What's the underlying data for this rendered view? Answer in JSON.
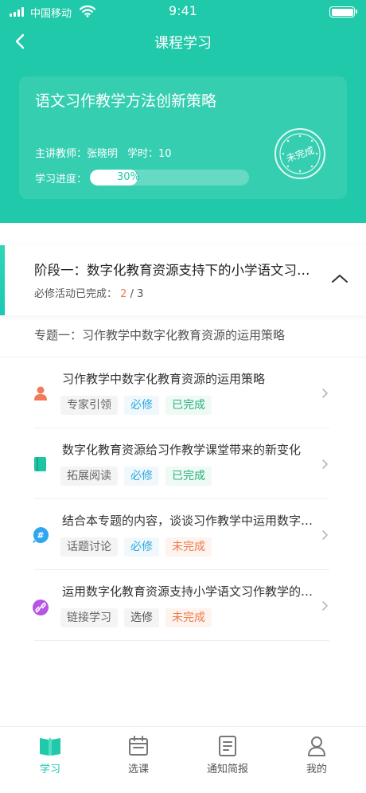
{
  "status_bar": {
    "carrier": "中国移动",
    "time": "9:41"
  },
  "nav": {
    "title": "课程学习"
  },
  "course": {
    "title": "语文习作教学方法创新策略",
    "teacher": "主讲教师：张晓明",
    "hours": "学时：10",
    "progress_label": "学习进度：",
    "progress_value": 30,
    "progress_text": "30%",
    "stamp_text": "未完成"
  },
  "stage": {
    "title": "阶段一：数字化教育资源支持下的小学语文习作教学",
    "progress_label": "必修活动已完成：",
    "completed": "2",
    "separator": "/",
    "total": "3"
  },
  "topic": {
    "title": "专题一：习作教学中数字化教育资源的运用策略"
  },
  "activities": [
    {
      "title": "习作教学中数字化教育资源的运用策略",
      "type": "专家引领",
      "requirement": "必修",
      "status": "已完成",
      "icon": "expert-icon"
    },
    {
      "title": "数字化教育资源给习作教学课堂带来的新变化",
      "type": "拓展阅读",
      "requirement": "必修",
      "status": "已完成",
      "icon": "book-icon"
    },
    {
      "title": "结合本专题的内容，谈谈习作教学中运用数字化教育资源的体会",
      "type": "话题讨论",
      "requirement": "必修",
      "status": "未完成",
      "icon": "topic-icon"
    },
    {
      "title": "运用数字化教育资源支持小学语文习作教学的案例",
      "type": "链接学习",
      "requirement": "选修",
      "status": "未完成",
      "icon": "link-icon"
    }
  ],
  "tabbar": {
    "items": [
      {
        "label": "学习",
        "icon": "book-open-icon",
        "active": true
      },
      {
        "label": "选课",
        "icon": "calendar-icon",
        "active": false
      },
      {
        "label": "通知简报",
        "icon": "notice-icon",
        "active": false
      },
      {
        "label": "我的",
        "icon": "user-icon",
        "active": false
      }
    ]
  },
  "colors": {
    "brand": "#20c9a9",
    "done": "#27b07a",
    "undone": "#f07b4a",
    "required": "#2aa8e0"
  }
}
